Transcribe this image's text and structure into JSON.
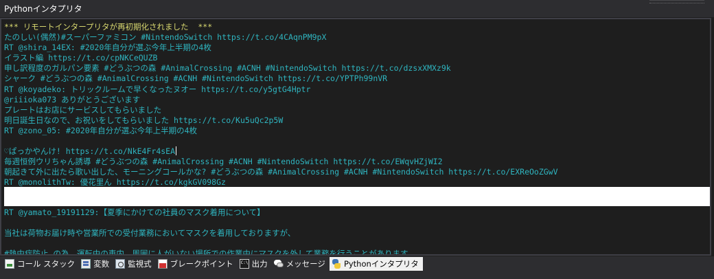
{
  "window": {
    "title": "Pythonインタプリタ"
  },
  "console": {
    "lines": [
      {
        "kind": "sys",
        "text": "*** リモートインタープリタが再初期化されました  ***"
      },
      {
        "kind": "out",
        "text": "たのしい(偶然)#スーパーファミコン #NintendoSwitch https://t.co/4CAqnPM9pX"
      },
      {
        "kind": "out",
        "text": "RT @shira_14EX: #2020年自分が選ぶ今年上半期の4枚"
      },
      {
        "kind": "out",
        "text": "イラスト編 https://t.co/cpNKCeQUZB"
      },
      {
        "kind": "out",
        "text": "申し訳程度のガルパン要素 #どうぶつの森 #AnimalCrossing #ACNH #NintendoSwitch https://t.co/dzsxXMXz9k"
      },
      {
        "kind": "out",
        "text": "シャーク #どうぶつの森 #AnimalCrossing #ACNH #NintendoSwitch https://t.co/YPTPh99nVR"
      },
      {
        "kind": "out",
        "text": "RT @koyadeko: トリックルームで早くなったヌオー https://t.co/y5gtG4Hptr"
      },
      {
        "kind": "out",
        "text": "@riiioka073 ありがとうございます"
      },
      {
        "kind": "out",
        "text": "プレートはお店にサービスしてもらいました"
      },
      {
        "kind": "out",
        "text": "明日誕生日なので、お祝いをしてもらいました https://t.co/Ku5uQc2p5W"
      },
      {
        "kind": "out",
        "text": "RT @zono_05: #2020年自分が選ぶ今年上半期の4枚"
      },
      {
        "kind": "out",
        "text": ""
      },
      {
        "kind": "out",
        "text": "♡ぱっかやんけ! https://t.co/NkE4Fr4sEA",
        "caret": true
      },
      {
        "kind": "out",
        "text": "毎週恒例ウリちゃん誘導 #どうぶつの森 #AnimalCrossing #ACNH #NintendoSwitch https://t.co/EWqvHZjWI2"
      },
      {
        "kind": "out",
        "text": "朝起きて外に出たら歌い出した、モーニングコールかな? #どうぶつの森 #AnimalCrossing #ACNH #NintendoSwitch https://t.co/EXReOoZGwV"
      },
      {
        "kind": "out",
        "text": "RT @monolithTw: 優花里ん https://t.co/kgkGV098Gz"
      }
    ],
    "input_value": "",
    "lines_after": [
      {
        "text": "RT @yamato_19191129:【夏季にかけての社員のマスク着用について】"
      },
      {
        "text": ""
      },
      {
        "text": "当社は荷物お届け時や営業所での受付業務においてマスクを着用しておりますが、"
      },
      {
        "text": ""
      },
      {
        "text": "#熱中症防止 の為、運転中の車内、周囲に人がいない場所での作業中にマスクを外して業務を行うことがあります。"
      }
    ]
  },
  "tabs": [
    {
      "name": "callstack",
      "label": "コール スタック",
      "icon": "callstack-icon",
      "active": false
    },
    {
      "name": "variables",
      "label": "変数",
      "icon": "variables-icon",
      "active": false
    },
    {
      "name": "watch",
      "label": "監視式",
      "icon": "watch-icon",
      "active": false
    },
    {
      "name": "breakpoints",
      "label": "ブレークポイント",
      "icon": "breakpoint-icon",
      "active": false
    },
    {
      "name": "output",
      "label": "出力",
      "icon": "output-icon",
      "active": false
    },
    {
      "name": "messages",
      "label": "メッセージ",
      "icon": "message-icon",
      "active": false
    },
    {
      "name": "python-interpreter",
      "label": "Pythonインタプリタ",
      "icon": "python-icon",
      "active": true
    }
  ],
  "colors": {
    "background": "#1e1e1e",
    "output_text": "#2fb5c0",
    "system_text": "#d7d76f",
    "chrome": "#2d2d30"
  }
}
